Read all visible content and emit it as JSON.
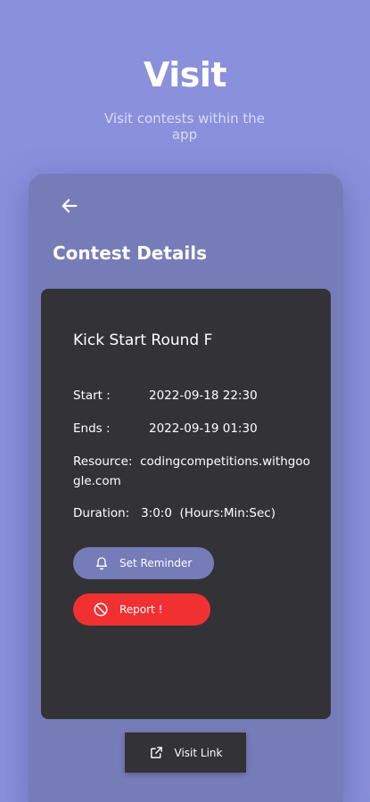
{
  "promo": {
    "title": "Visit",
    "subtitle": "Visit contests within the app"
  },
  "screen": {
    "back_icon": "arrow-left-icon",
    "title": "Contest Details"
  },
  "contest": {
    "name": "Kick Start Round F",
    "start_label": "Start :",
    "start_value": "2022-09-18 22:30",
    "ends_label": "Ends :",
    "ends_value": "2022-09-19 01:30",
    "resource_label": "Resource:",
    "resource_value": "codingcompetitions.withgoogle.com",
    "duration_label": "Duration:",
    "duration_value": "3:0:0",
    "duration_unit": "(Hours:Min:Sec)"
  },
  "actions": {
    "reminder_label": "Set Reminder",
    "reminder_icon": "bell-icon",
    "report_label": "Report !",
    "report_icon": "block-icon",
    "visit_label": "Visit Link",
    "visit_icon": "external-link-icon"
  },
  "colors": {
    "background": "#8a90db",
    "phone_surface": "#767cb8",
    "card": "#333337",
    "report": "#f13131"
  }
}
